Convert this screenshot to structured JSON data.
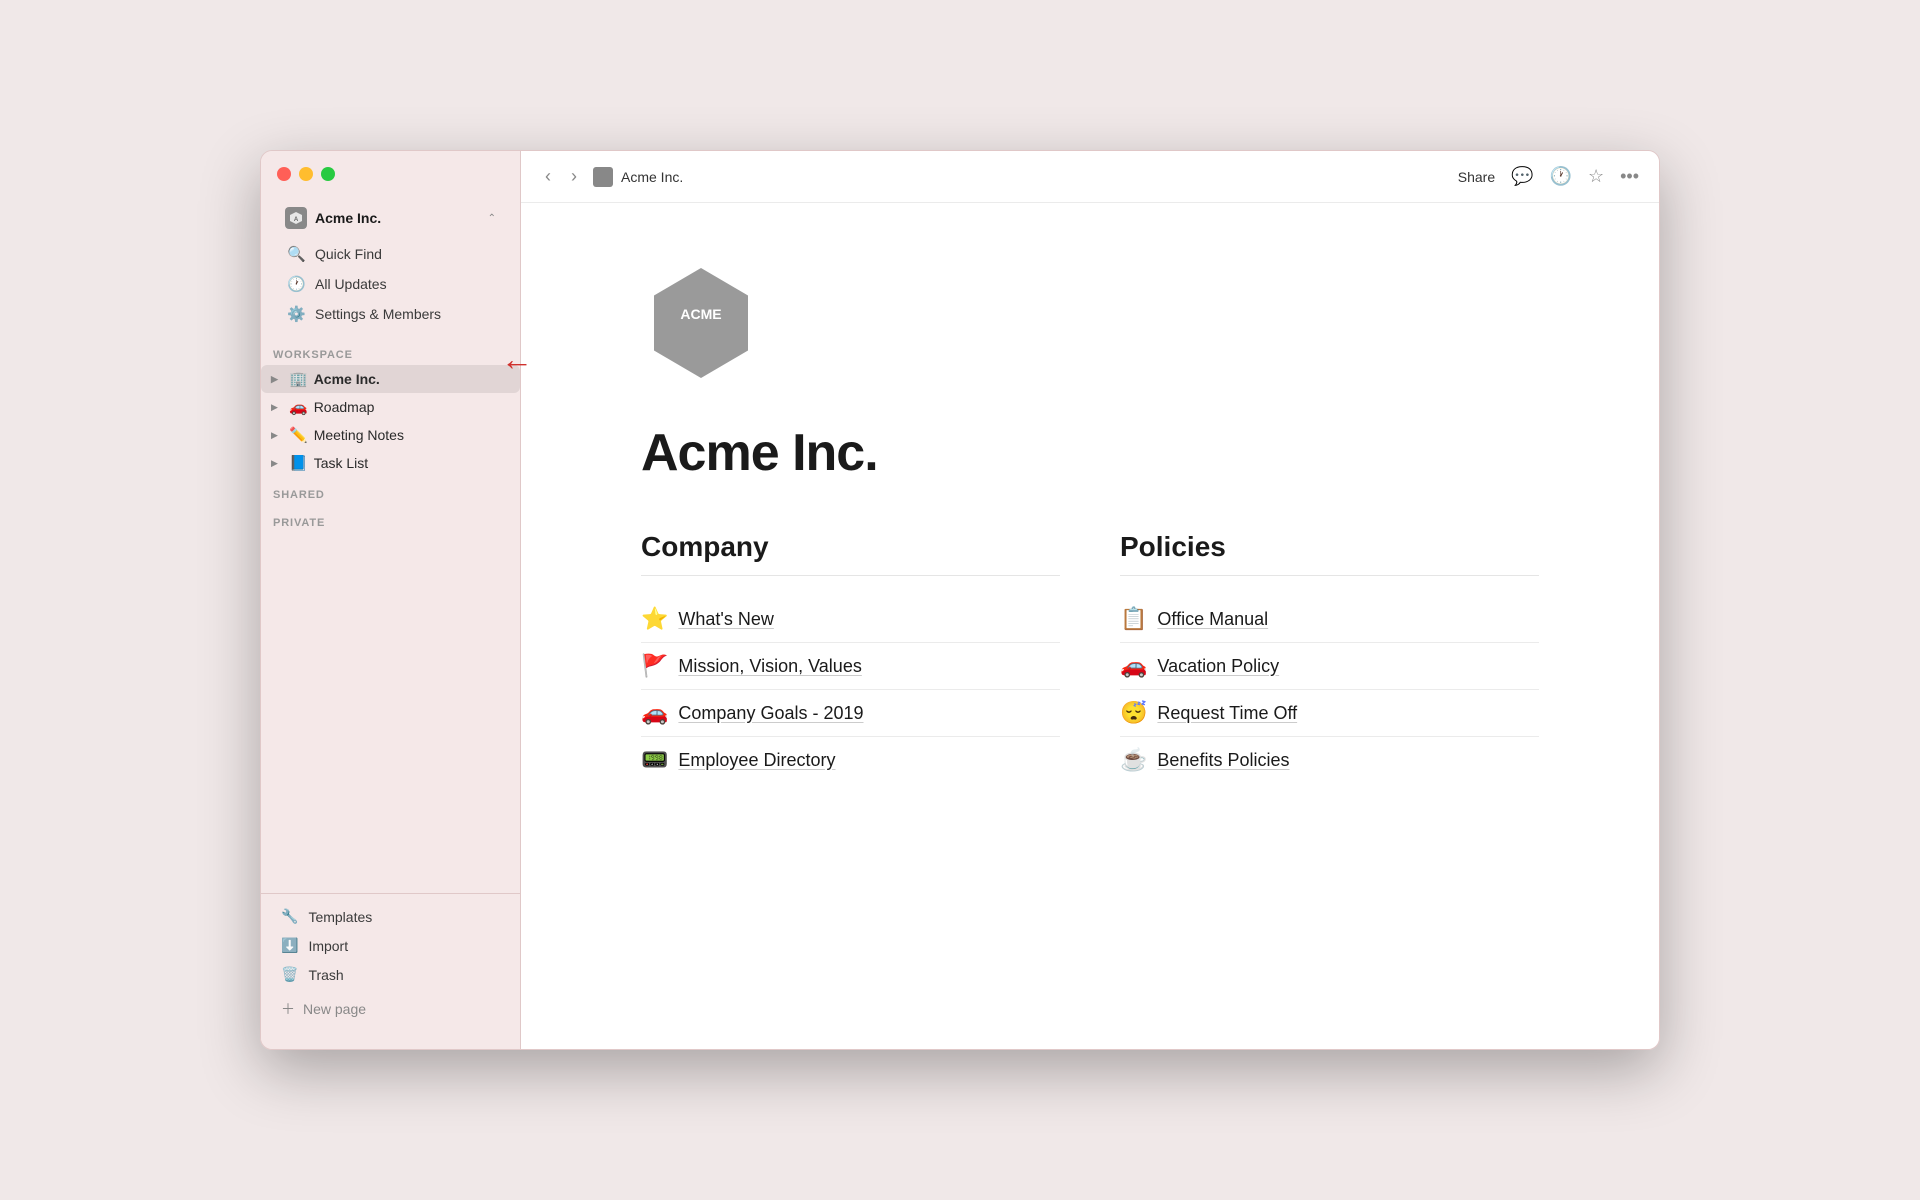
{
  "window": {
    "title": "Acme Inc."
  },
  "sidebar": {
    "workspace_name": "Acme Inc.",
    "nav_items": [
      {
        "id": "quick-find",
        "icon": "🔍",
        "label": "Quick Find"
      },
      {
        "id": "all-updates",
        "icon": "🕐",
        "label": "All Updates"
      },
      {
        "id": "settings",
        "icon": "⚙️",
        "label": "Settings & Members"
      }
    ],
    "workspace_section": "WORKSPACE",
    "tree_items": [
      {
        "id": "acme-inc",
        "emoji": "🏢",
        "label": "Acme Inc.",
        "active": true
      },
      {
        "id": "roadmap",
        "emoji": "🚗",
        "label": "Roadmap"
      },
      {
        "id": "meeting-notes",
        "emoji": "✏️",
        "label": "Meeting Notes"
      },
      {
        "id": "task-list",
        "emoji": "📘",
        "label": "Task List"
      }
    ],
    "shared_section": "SHARED",
    "private_section": "PRIVATE",
    "bottom_items": [
      {
        "id": "templates",
        "emoji": "🔧",
        "label": "Templates"
      },
      {
        "id": "import",
        "emoji": "⬇️",
        "label": "Import"
      },
      {
        "id": "trash",
        "emoji": "🗑️",
        "label": "Trash"
      }
    ],
    "new_page": "New page"
  },
  "titlebar": {
    "page_title": "Acme Inc.",
    "share_label": "Share"
  },
  "content": {
    "page_title": "Acme Inc.",
    "company_section": {
      "title": "Company",
      "links": [
        {
          "emoji": "⭐",
          "label": "What's New"
        },
        {
          "emoji": "🚩",
          "label": "Mission, Vision, Values"
        },
        {
          "emoji": "🚗",
          "label": "Company Goals - 2019"
        },
        {
          "emoji": "📟",
          "label": "Employee Directory"
        }
      ]
    },
    "policies_section": {
      "title": "Policies",
      "links": [
        {
          "emoji": "📋",
          "label": "Office Manual"
        },
        {
          "emoji": "🚗",
          "label": "Vacation Policy"
        },
        {
          "emoji": "😴",
          "label": "Request Time Off"
        },
        {
          "emoji": "☕",
          "label": "Benefits Policies"
        }
      ]
    }
  }
}
